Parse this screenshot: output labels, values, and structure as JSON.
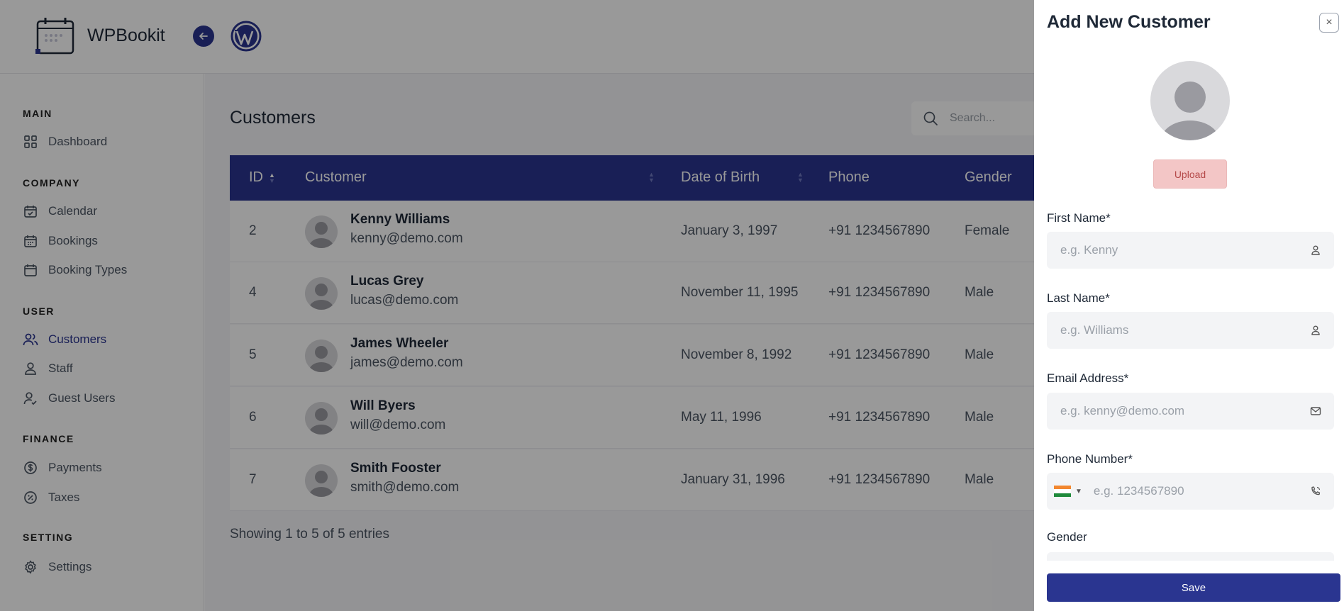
{
  "header": {
    "app_title": "WPBookit"
  },
  "sidebar": {
    "sections": [
      {
        "title": "MAIN",
        "items": [
          {
            "label": "Dashboard",
            "icon": "grid-icon"
          }
        ]
      },
      {
        "title": "COMPANY",
        "items": [
          {
            "label": "Calendar",
            "icon": "calendar-check-icon"
          },
          {
            "label": "Bookings",
            "icon": "calendar-grid-icon"
          },
          {
            "label": "Booking Types",
            "icon": "calendar-icon"
          }
        ]
      },
      {
        "title": "USER",
        "items": [
          {
            "label": "Customers",
            "icon": "users-icon",
            "active": true
          },
          {
            "label": "Staff",
            "icon": "user-icon"
          },
          {
            "label": "Guest Users",
            "icon": "user-check-icon"
          }
        ]
      },
      {
        "title": "FINANCE",
        "items": [
          {
            "label": "Payments",
            "icon": "dollar-circle-icon"
          },
          {
            "label": "Taxes",
            "icon": "percent-badge-icon"
          }
        ]
      },
      {
        "title": "SETTING",
        "items": [
          {
            "label": "Settings",
            "icon": "gear-icon"
          }
        ]
      }
    ]
  },
  "main": {
    "page_title": "Customers",
    "search_placeholder": "Search...",
    "table": {
      "columns": [
        "ID",
        "Customer",
        "Date of Birth",
        "Phone",
        "Gender"
      ],
      "rows": [
        {
          "id": "2",
          "name": "Kenny Williams",
          "email": "kenny@demo.com",
          "dob": "January 3, 1997",
          "phone": "+91 1234567890",
          "gender": "Female"
        },
        {
          "id": "4",
          "name": "Lucas Grey",
          "email": "lucas@demo.com",
          "dob": "November 11, 1995",
          "phone": "+91 1234567890",
          "gender": "Male"
        },
        {
          "id": "5",
          "name": "James Wheeler",
          "email": "james@demo.com",
          "dob": "November 8, 1992",
          "phone": "+91 1234567890",
          "gender": "Male"
        },
        {
          "id": "6",
          "name": "Will Byers",
          "email": "will@demo.com",
          "dob": "May 11, 1996",
          "phone": "+91 1234567890",
          "gender": "Male"
        },
        {
          "id": "7",
          "name": "Smith Fooster",
          "email": "smith@demo.com",
          "dob": "January 31, 1996",
          "phone": "+91 1234567890",
          "gender": "Male"
        }
      ]
    },
    "footer_text": "Showing 1 to 5 of 5 entries"
  },
  "drawer": {
    "title": "Add New Customer",
    "close_icon": "×",
    "upload_label": "Upload",
    "fields": {
      "first_name": {
        "label": "First Name*",
        "placeholder": "e.g. Kenny"
      },
      "last_name": {
        "label": "Last Name*",
        "placeholder": "e.g. Williams"
      },
      "email": {
        "label": "Email Address*",
        "placeholder": "e.g. kenny@demo.com"
      },
      "phone": {
        "label": "Phone Number*",
        "placeholder": "e.g. 1234567890"
      },
      "gender": {
        "label": "Gender"
      }
    },
    "save_label": "Save"
  },
  "colors": {
    "primary": "#2a3590",
    "upload_bg": "#f3c6c6",
    "overlay": "rgba(0,0,0,0.4)"
  }
}
